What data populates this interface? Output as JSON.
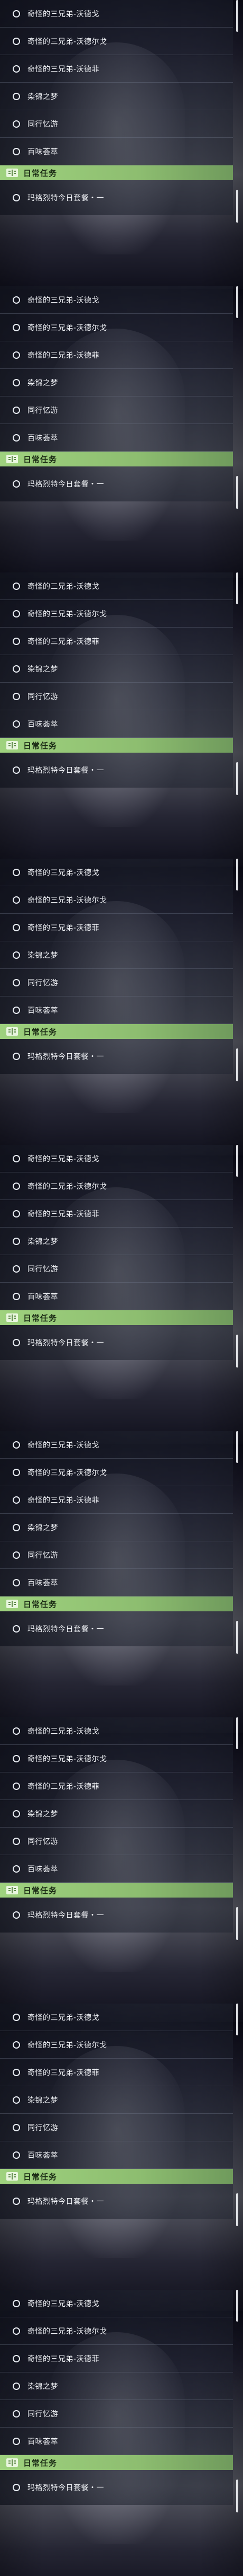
{
  "panels": [
    {
      "tasks": [
        {
          "label": "奇怪的三兄弟-沃德戈"
        },
        {
          "label": "奇怪的三兄弟-沃德尔戈"
        },
        {
          "label": "奇怪的三兄弟-沃德菲"
        },
        {
          "label": "染锦之梦"
        },
        {
          "label": "同行忆游"
        },
        {
          "label": "百味荟萃"
        }
      ],
      "daily_header": "日常任务",
      "daily_quest": "玛格烈特今日套餐・一"
    },
    {
      "tasks": [
        {
          "label": "奇怪的三兄弟-沃德戈"
        },
        {
          "label": "奇怪的三兄弟-沃德尔戈"
        },
        {
          "label": "奇怪的三兄弟-沃德菲"
        },
        {
          "label": "染锦之梦"
        },
        {
          "label": "同行忆游"
        },
        {
          "label": "百味荟萃"
        }
      ],
      "daily_header": "日常任务",
      "daily_quest": "玛格烈特今日套餐・一"
    },
    {
      "tasks": [
        {
          "label": "奇怪的三兄弟-沃德戈"
        },
        {
          "label": "奇怪的三兄弟-沃德尔戈"
        },
        {
          "label": "奇怪的三兄弟-沃德菲"
        },
        {
          "label": "染锦之梦"
        },
        {
          "label": "同行忆游"
        },
        {
          "label": "百味荟萃"
        }
      ],
      "daily_header": "日常任务",
      "daily_quest": "玛格烈特今日套餐・一"
    },
    {
      "tasks": [
        {
          "label": "奇怪的三兄弟-沃德戈"
        },
        {
          "label": "奇怪的三兄弟-沃德尔戈"
        },
        {
          "label": "奇怪的三兄弟-沃德菲"
        },
        {
          "label": "染锦之梦"
        },
        {
          "label": "同行忆游"
        },
        {
          "label": "百味荟萃"
        }
      ],
      "daily_header": "日常任务",
      "daily_quest": "玛格烈特今日套餐・一"
    },
    {
      "tasks": [
        {
          "label": "奇怪的三兄弟-沃德戈"
        },
        {
          "label": "奇怪的三兄弟-沃德尔戈"
        },
        {
          "label": "奇怪的三兄弟-沃德菲"
        },
        {
          "label": "染锦之梦"
        },
        {
          "label": "同行忆游"
        },
        {
          "label": "百味荟萃"
        }
      ],
      "daily_header": "日常任务",
      "daily_quest": "玛格烈特今日套餐・一"
    },
    {
      "tasks": [
        {
          "label": "奇怪的三兄弟-沃德戈"
        },
        {
          "label": "奇怪的三兄弟-沃德尔戈"
        },
        {
          "label": "奇怪的三兄弟-沃德菲"
        },
        {
          "label": "染锦之梦"
        },
        {
          "label": "同行忆游"
        },
        {
          "label": "百味荟萃"
        }
      ],
      "daily_header": "日常任务",
      "daily_quest": "玛格烈特今日套餐・一"
    },
    {
      "tasks": [
        {
          "label": "奇怪的三兄弟-沃德戈"
        },
        {
          "label": "奇怪的三兄弟-沃德尔戈"
        },
        {
          "label": "奇怪的三兄弟-沃德菲"
        },
        {
          "label": "染锦之梦"
        },
        {
          "label": "同行忆游"
        },
        {
          "label": "百味荟萃"
        }
      ],
      "daily_header": "日常任务",
      "daily_quest": "玛格烈特今日套餐・一"
    },
    {
      "tasks": [
        {
          "label": "奇怪的三兄弟-沃德戈"
        },
        {
          "label": "奇怪的三兄弟-沃德尔戈"
        },
        {
          "label": "奇怪的三兄弟-沃德菲"
        },
        {
          "label": "染锦之梦"
        },
        {
          "label": "同行忆游"
        },
        {
          "label": "百味荟萃"
        }
      ],
      "daily_header": "日常任务",
      "daily_quest": "玛格烈特今日套餐・一"
    },
    {
      "tasks": [
        {
          "label": "奇怪的三兄弟-沃德戈"
        },
        {
          "label": "奇怪的三兄弟-沃德尔戈"
        },
        {
          "label": "奇怪的三兄弟-沃德菲"
        },
        {
          "label": "染锦之梦"
        },
        {
          "label": "同行忆游"
        },
        {
          "label": "百味荟萃"
        }
      ],
      "daily_header": "日常任务",
      "daily_quest": "玛格烈特今日套餐・一"
    }
  ],
  "icons": {
    "task_marker": "circle-outline-icon",
    "daily_header": "book-icon"
  },
  "colors": {
    "daily_header_green": "#9fd27e",
    "text": "#eef0f4"
  }
}
